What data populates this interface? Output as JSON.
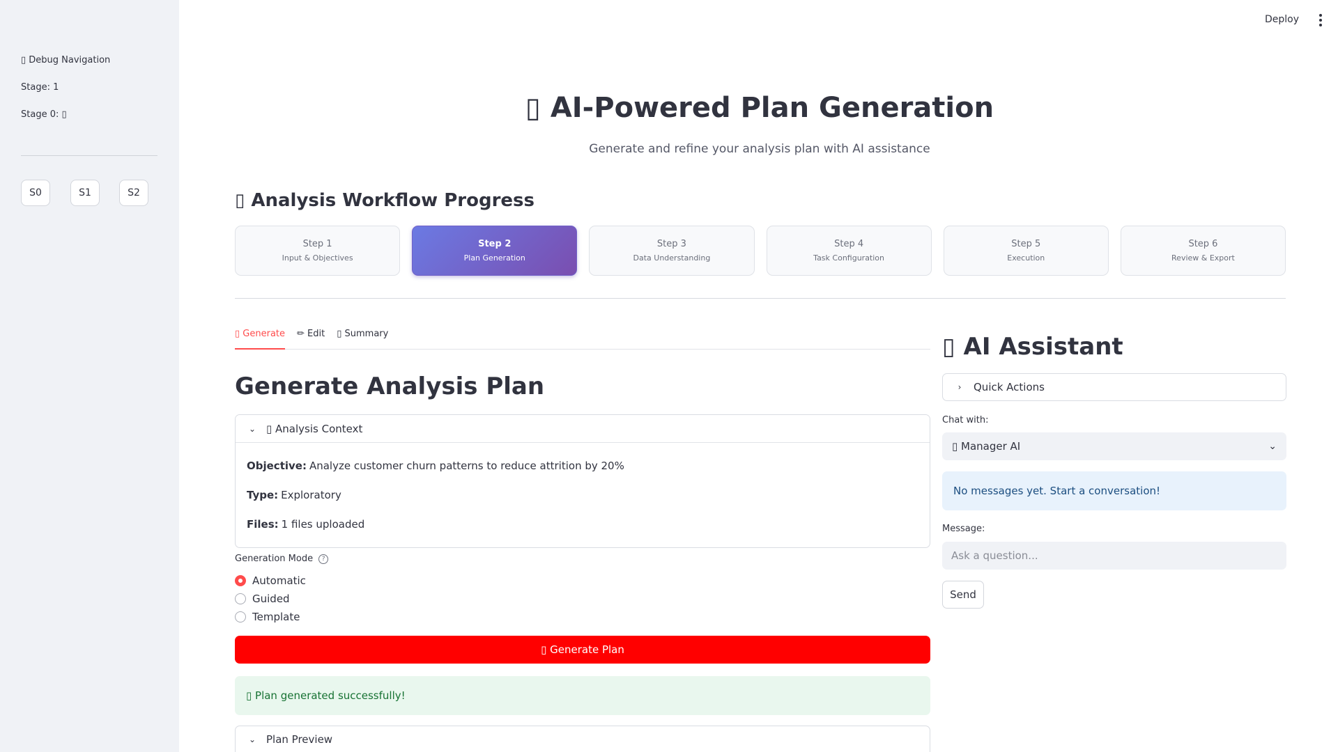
{
  "sidebar": {
    "debug_title": "▯ Debug Navigation",
    "stage": "Stage: 1",
    "stage0": "Stage 0: ▯",
    "buttons": [
      "S0",
      "S1",
      "S2"
    ]
  },
  "topbar": {
    "deploy_label": "Deploy"
  },
  "header": {
    "title": "▯ AI-Powered Plan Generation",
    "subtitle": "Generate and refine your analysis plan with AI assistance"
  },
  "workflow": {
    "heading": "▯ Analysis Workflow Progress",
    "active_step": 2,
    "steps": [
      {
        "num": "Step 1",
        "label": "Input & Objectives"
      },
      {
        "num": "Step 2",
        "label": "Plan Generation"
      },
      {
        "num": "Step 3",
        "label": "Data Understanding"
      },
      {
        "num": "Step 4",
        "label": "Task Configuration"
      },
      {
        "num": "Step 5",
        "label": "Execution"
      },
      {
        "num": "Step 6",
        "label": "Review & Export"
      }
    ]
  },
  "tabs": [
    {
      "label": "▯ Generate"
    },
    {
      "label": "✏ Edit"
    },
    {
      "label": "▯ Summary"
    }
  ],
  "generate": {
    "heading": "Generate Analysis Plan",
    "context": {
      "title": "▯ Analysis Context",
      "objective_label": "Objective:",
      "objective_value": "Analyze customer churn patterns to reduce attrition by 20%",
      "type_label": "Type:",
      "type_value": "Exploratory",
      "files_label": "Files:",
      "files_value": "1 files uploaded"
    },
    "mode_label": "Generation Mode",
    "modes": [
      "Automatic",
      "Guided",
      "Template"
    ],
    "selected_mode": "Automatic",
    "button_label": "▯ Generate Plan",
    "success_message": "▯ Plan generated successfully!",
    "preview_title": "Plan Preview"
  },
  "assistant": {
    "title": "▯ AI Assistant",
    "quick_actions": "Quick Actions",
    "chat_label": "Chat with:",
    "chat_selected": "▯ Manager AI",
    "empty_message": "No messages yet. Start a conversation!",
    "message_label": "Message:",
    "message_placeholder": "Ask a question...",
    "send_label": "Send"
  },
  "colors": {
    "accent": "#ff4b4b",
    "primary_button": "#ff0000",
    "active_step_start": "#6b7ae3",
    "active_step_end": "#7a4eb0"
  }
}
